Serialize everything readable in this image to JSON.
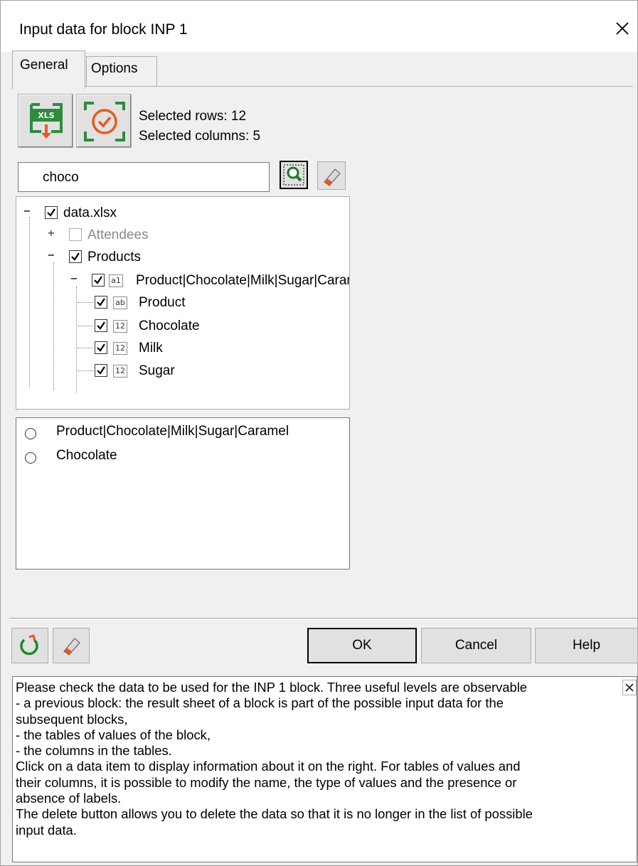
{
  "window": {
    "title": "Input data for block INP 1"
  },
  "tabs": [
    {
      "label": "General"
    },
    {
      "label": "Options"
    }
  ],
  "selection": {
    "rows": "Selected rows: 12",
    "columns": "Selected columns: 5"
  },
  "toolbar": {
    "import_icon_text": "XLS"
  },
  "search": {
    "value": "choco"
  },
  "tree": {
    "root": {
      "label": "data.xlsx",
      "checked": true,
      "expanded": true
    },
    "nodes": [
      {
        "label": "Attendees",
        "checked": false,
        "expanded": false,
        "disabled": true
      },
      {
        "label": "Products",
        "checked": true,
        "expanded": true
      },
      {
        "label": "Product|Chocolate|Milk|Sugar|Caramel",
        "type_icon": "a1",
        "checked": true,
        "expanded": true
      },
      {
        "label": "Product",
        "type_icon": "ab",
        "checked": true
      },
      {
        "label": "Chocolate",
        "type_icon": "12",
        "checked": true
      },
      {
        "label": "Milk",
        "type_icon": "12",
        "checked": true
      },
      {
        "label": "Sugar",
        "type_icon": "12",
        "checked": true
      }
    ]
  },
  "results": [
    {
      "label": "Product|Chocolate|Milk|Sugar|Caramel"
    },
    {
      "label": "Chocolate"
    }
  ],
  "buttons": {
    "ok": "OK",
    "cancel": "Cancel",
    "help": "Help"
  },
  "help": {
    "lines": [
      "Please check the data to be used for the INP 1 block. Three useful levels are observable",
      "- a previous block: the result sheet of a block is part of the possible input data for the",
      "subsequent blocks,",
      "- the tables of values of the block,",
      "- the columns in the tables.",
      "Click on a data item to display information about it on the right. For tables of values and",
      "their columns, it is possible to modify the name, the type of values and the presence or",
      "absence of labels.",
      "The delete button allows you to delete the data so that it is no longer in the list of possible",
      "input data."
    ]
  },
  "colors": {
    "green": "#2e8b3e",
    "orange": "#e65a1e",
    "face": "#e1e1e1",
    "window": "#f0f0f0"
  }
}
